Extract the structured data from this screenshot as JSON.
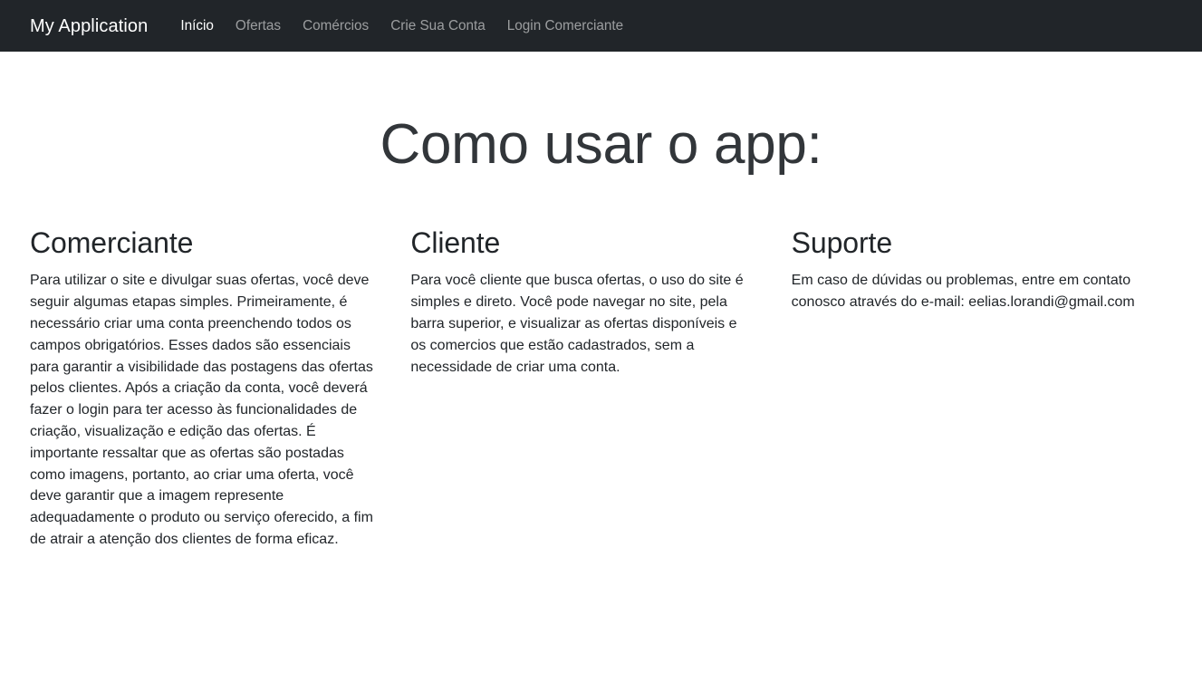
{
  "theme": {
    "navbar_bg": "#212529",
    "navbar_brand_color": "#ffffff",
    "navbar_link_color": "rgba(255,255,255,0.55)",
    "navbar_link_active_color": "#ffffff",
    "page_bg": "#ffffff",
    "heading_color": "#32363a",
    "body_text_color": "#212529"
  },
  "navbar": {
    "brand": "My Application",
    "items": [
      {
        "label": "Início",
        "active": true
      },
      {
        "label": "Ofertas",
        "active": false
      },
      {
        "label": "Comércios",
        "active": false
      },
      {
        "label": "Crie Sua Conta",
        "active": false
      },
      {
        "label": "Login Comerciante",
        "active": false
      }
    ]
  },
  "main": {
    "title": "Como usar o app:",
    "columns": [
      {
        "heading": "Comerciante",
        "text": "Para utilizar o site e divulgar suas ofertas, você deve seguir algumas etapas simples. Primeiramente, é necessário criar uma conta preenchendo todos os campos obrigatórios. Esses dados são essenciais para garantir a visibilidade das postagens das ofertas pelos clientes. Após a criação da conta, você deverá fazer o login para ter acesso às funcionalidades de criação, visualização e edição das ofertas. É importante ressaltar que as ofertas são postadas como imagens, portanto, ao criar uma oferta, você deve garantir que a imagem represente adequadamente o produto ou serviço oferecido, a fim de atrair a atenção dos clientes de forma eficaz."
      },
      {
        "heading": "Cliente",
        "text": "Para você cliente que busca ofertas, o uso do site é simples e direto. Você pode navegar no site, pela barra superior, e visualizar as ofertas disponíveis e os comercios que estão cadastrados, sem a necessidade de criar uma conta."
      },
      {
        "heading": "Suporte",
        "text": "Em caso de dúvidas ou problemas, entre em contato conosco através do e-mail: eelias.lorandi@gmail.com"
      }
    ]
  }
}
